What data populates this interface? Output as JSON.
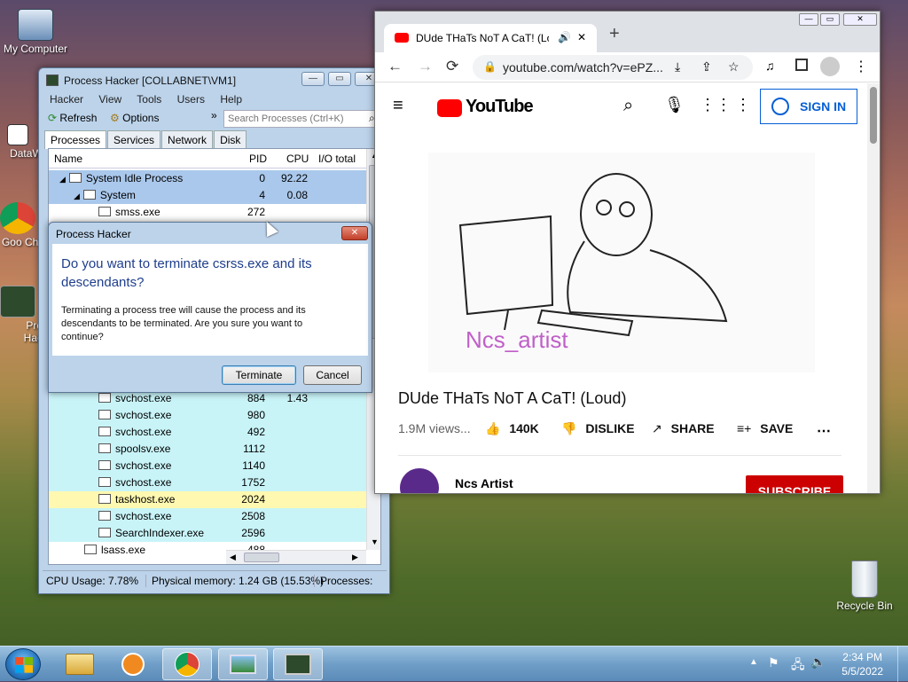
{
  "desktop": {
    "icons": [
      {
        "label": "My Computer"
      },
      {
        "label": "DataWa"
      },
      {
        "label": "Goo Chro"
      },
      {
        "label": "Proc Hack"
      },
      {
        "label": "Recycle Bin"
      }
    ]
  },
  "process_hacker": {
    "title": "Process Hacker [COLLABNET\\VM1]",
    "menu": [
      "Hacker",
      "View",
      "Tools",
      "Users",
      "Help"
    ],
    "toolbar": {
      "refresh": "Refresh",
      "options": "Options",
      "search_placeholder": "Search Processes (Ctrl+K)"
    },
    "tabs": [
      "Processes",
      "Services",
      "Network",
      "Disk"
    ],
    "columns": {
      "name": "Name",
      "pid": "PID",
      "cpu": "CPU",
      "io": "I/O total ..."
    },
    "rows_top": [
      {
        "name": "System Idle Process",
        "pid": "0",
        "cpu": "92.22"
      },
      {
        "name": "System",
        "pid": "4",
        "cpu": "0.08"
      },
      {
        "name": "smss.exe",
        "pid": "272",
        "cpu": ""
      }
    ],
    "rows_bottom": [
      {
        "name": "svchost.exe",
        "pid": "884",
        "cpu": "1.43"
      },
      {
        "name": "svchost.exe",
        "pid": "980",
        "cpu": ""
      },
      {
        "name": "svchost.exe",
        "pid": "492",
        "cpu": ""
      },
      {
        "name": "spoolsv.exe",
        "pid": "1112",
        "cpu": ""
      },
      {
        "name": "svchost.exe",
        "pid": "1140",
        "cpu": ""
      },
      {
        "name": "svchost.exe",
        "pid": "1752",
        "cpu": ""
      },
      {
        "name": "taskhost.exe",
        "pid": "2024",
        "cpu": ""
      },
      {
        "name": "svchost.exe",
        "pid": "2508",
        "cpu": ""
      },
      {
        "name": "SearchIndexer.exe",
        "pid": "2596",
        "cpu": ""
      },
      {
        "name": "lsass.exe",
        "pid": "488",
        "cpu": ""
      }
    ],
    "status": {
      "cpu": "CPU Usage: 7.78%",
      "mem": "Physical memory: 1.24 GB (15.53%)",
      "procs": "Processes: "
    }
  },
  "dialog": {
    "title": "Process Hacker",
    "heading": "Do you want to terminate csrss.exe and its descendants?",
    "body": "Terminating a process tree will cause the process and its descendants to be terminated. Are you sure you want to continue?",
    "terminate": "Terminate",
    "cancel": "Cancel"
  },
  "chrome": {
    "tab_title": "DUde THaTs NoT A CaT! (Lo",
    "url": "youtube.com/watch?v=ePZ...",
    "youtube": {
      "logo": "YouTube",
      "sign_in": "SIGN IN",
      "video_title": "DUde THaTs NoT A CaT! (Loud)",
      "views": "1.9M views...",
      "likes": "140K",
      "dislike": "DISLIKE",
      "share": "SHARE",
      "save": "SAVE",
      "channel": "Ncs Artist",
      "subscribe": "SUBSCRIBE",
      "thumb_caption": "Ncs_artist"
    }
  },
  "taskbar": {
    "time": "2:34 PM",
    "date": "5/5/2022"
  }
}
